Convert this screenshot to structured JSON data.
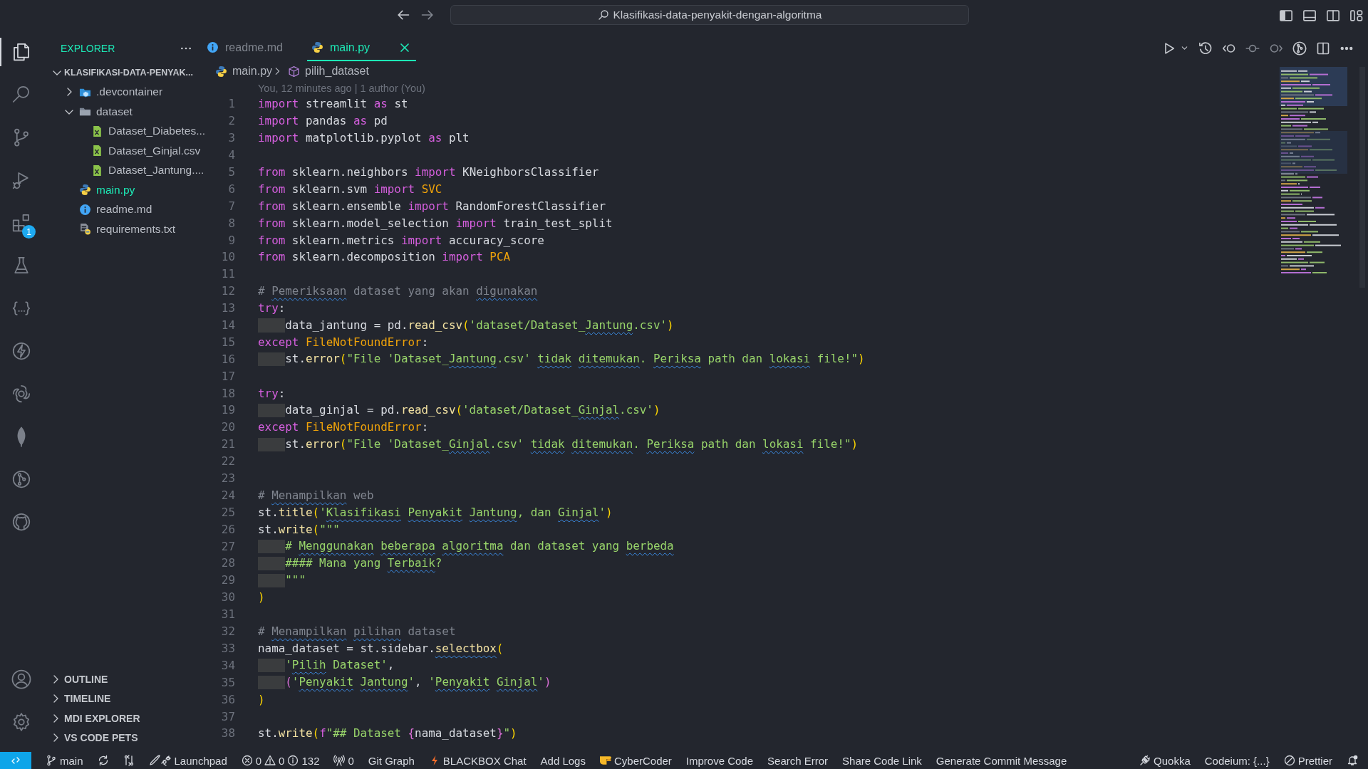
{
  "title_bar": {
    "search": "Klasifikasi-data-penyakit-dengan-algoritma"
  },
  "activity_bar": [
    {
      "kind": "explorer",
      "selected": true
    },
    {
      "kind": "search",
      "selected": false
    },
    {
      "kind": "source-control",
      "selected": false
    },
    {
      "kind": "run",
      "selected": false
    },
    {
      "kind": "extensions",
      "selected": false,
      "badge": "1"
    },
    {
      "kind": "flask",
      "selected": false
    },
    {
      "kind": "braces",
      "selected": false
    },
    {
      "kind": "bolt",
      "selected": false
    },
    {
      "kind": "knot",
      "selected": false
    },
    {
      "kind": "leaf",
      "selected": false
    },
    {
      "kind": "graph",
      "selected": false
    },
    {
      "kind": "cat",
      "selected": false
    }
  ],
  "activity_bottom": [
    {
      "kind": "account"
    },
    {
      "kind": "settings"
    }
  ],
  "sidebar": {
    "title": "EXPLORER",
    "tree": [
      {
        "label": "KLASIFIKASI-DATA-PENYAK...",
        "kind": "root",
        "expanded": true,
        "selected": false,
        "children": [
          {
            "label": ".devcontainer",
            "kind": "container-folder",
            "expanded": false,
            "selected": false
          },
          {
            "label": "dataset",
            "kind": "folder",
            "expanded": true,
            "selected": false,
            "children": [
              {
                "label": "Dataset_Diabetes...",
                "kind": "csv",
                "selected": false
              },
              {
                "label": "Dataset_Ginjal.csv",
                "kind": "csv",
                "selected": false
              },
              {
                "label": "Dataset_Jantung....",
                "kind": "csv",
                "selected": false
              }
            ]
          },
          {
            "label": "main.py",
            "kind": "python",
            "selected": true
          },
          {
            "label": "readme.md",
            "kind": "info",
            "selected": false
          },
          {
            "label": "requirements.txt",
            "kind": "requirements",
            "selected": false
          }
        ]
      }
    ],
    "sections": [
      {
        "label": "OUTLINE",
        "expanded": false
      },
      {
        "label": "TIMELINE",
        "expanded": false
      },
      {
        "label": "MDI EXPLORER",
        "expanded": false
      },
      {
        "label": "VS CODE PETS",
        "expanded": false
      }
    ]
  },
  "tabs": [
    {
      "label": "readme.md",
      "kind": "info",
      "selected": false
    },
    {
      "label": "main.py",
      "kind": "python",
      "selected": true
    }
  ],
  "breadcrumb": [
    {
      "label": "main.py",
      "kind": "python"
    },
    {
      "label": "pilih_dataset",
      "kind": "symbol"
    }
  ],
  "blame": "You, 12 minutes ago | 1 author (You)",
  "code": [
    {
      "number": "1",
      "tokens": [
        {
          "text": "import",
          "kind": "keyword"
        },
        {
          "text": " streamlit ",
          "kind": "plain"
        },
        {
          "text": "as",
          "kind": "keyword"
        },
        {
          "text": " st",
          "kind": "plain"
        }
      ]
    },
    {
      "number": "2",
      "tokens": [
        {
          "text": "import",
          "kind": "keyword"
        },
        {
          "text": " pandas ",
          "kind": "plain"
        },
        {
          "text": "as",
          "kind": "keyword"
        },
        {
          "text": " pd",
          "kind": "plain"
        }
      ]
    },
    {
      "number": "3",
      "tokens": [
        {
          "text": "import",
          "kind": "keyword"
        },
        {
          "text": " matplotlib.pyplot ",
          "kind": "plain"
        },
        {
          "text": "as",
          "kind": "keyword"
        },
        {
          "text": " plt",
          "kind": "plain"
        }
      ]
    },
    {
      "number": "4"
    },
    {
      "number": "5",
      "tokens": [
        {
          "text": "from",
          "kind": "keyword"
        },
        {
          "text": " sklearn.neighbors ",
          "kind": "plain"
        },
        {
          "text": "import",
          "kind": "keyword"
        },
        {
          "text": " KNeighborsClassifier",
          "kind": "plain"
        }
      ]
    },
    {
      "number": "6",
      "tokens": [
        {
          "text": "from",
          "kind": "keyword"
        },
        {
          "text": " sklearn.svm ",
          "kind": "plain"
        },
        {
          "text": "import",
          "kind": "keyword"
        },
        {
          "text": " SVC",
          "kind": "class"
        }
      ]
    },
    {
      "number": "7",
      "tokens": [
        {
          "text": "from",
          "kind": "keyword"
        },
        {
          "text": " sklearn.ensemble ",
          "kind": "plain"
        },
        {
          "text": "import",
          "kind": "keyword"
        },
        {
          "text": " RandomForestClassifier",
          "kind": "plain"
        }
      ]
    },
    {
      "number": "8",
      "tokens": [
        {
          "text": "from",
          "kind": "keyword"
        },
        {
          "text": " sklearn.model_selection ",
          "kind": "plain"
        },
        {
          "text": "import",
          "kind": "keyword"
        },
        {
          "text": " train_test_split",
          "kind": "plain"
        }
      ]
    },
    {
      "number": "9",
      "tokens": [
        {
          "text": "from",
          "kind": "keyword"
        },
        {
          "text": " sklearn.metrics ",
          "kind": "plain"
        },
        {
          "text": "import",
          "kind": "keyword"
        },
        {
          "text": " accuracy_score",
          "kind": "plain"
        }
      ]
    },
    {
      "number": "10",
      "tokens": [
        {
          "text": "from",
          "kind": "keyword"
        },
        {
          "text": " sklearn.decomposition ",
          "kind": "plain"
        },
        {
          "text": "import",
          "kind": "keyword"
        },
        {
          "text": " PCA",
          "kind": "class"
        }
      ]
    },
    {
      "number": "11"
    },
    {
      "number": "12",
      "tokens": [
        {
          "text": "# ",
          "kind": "comment"
        },
        {
          "text": "Pemeriksaan",
          "kind": "comment_typo"
        },
        {
          "text": " dataset yang akan ",
          "kind": "comment"
        },
        {
          "text": "digunakan",
          "kind": "comment_typo"
        }
      ]
    },
    {
      "number": "13",
      "tokens": [
        {
          "text": "try",
          "kind": "keyword"
        },
        {
          "text": ":",
          "kind": "plain"
        }
      ]
    },
    {
      "number": "14",
      "tokens": [
        {
          "kind": "indent"
        },
        {
          "text": "data_jantung = pd.",
          "kind": "plain"
        },
        {
          "text": "read_csv",
          "kind": "function"
        },
        {
          "text": "(",
          "kind": "bracket"
        },
        {
          "text": "'dataset/Dataset_",
          "kind": "string"
        },
        {
          "text": "Jantung",
          "kind": "string_typo"
        },
        {
          "text": ".csv'",
          "kind": "string"
        },
        {
          "text": ")",
          "kind": "bracket"
        }
      ]
    },
    {
      "number": "15",
      "tokens": [
        {
          "text": "except",
          "kind": "keyword"
        },
        {
          "text": " FileNotFoundError",
          "kind": "class"
        },
        {
          "text": ":",
          "kind": "plain"
        }
      ]
    },
    {
      "number": "16",
      "tokens": [
        {
          "kind": "indent"
        },
        {
          "text": "st.",
          "kind": "plain"
        },
        {
          "text": "error",
          "kind": "function"
        },
        {
          "text": "(",
          "kind": "bracket"
        },
        {
          "text": "\"File 'Dataset_",
          "kind": "string"
        },
        {
          "text": "Jantung",
          "kind": "string_typo"
        },
        {
          "text": ".csv' ",
          "kind": "string"
        },
        {
          "text": "tidak",
          "kind": "string_typo"
        },
        {
          "text": " ditemukan",
          "kind": "string_typo"
        },
        {
          "text": ". ",
          "kind": "string"
        },
        {
          "text": "Periksa",
          "kind": "string_typo"
        },
        {
          "text": " path dan ",
          "kind": "string"
        },
        {
          "text": "lokasi",
          "kind": "string_typo"
        },
        {
          "text": " file!\"",
          "kind": "string"
        },
        {
          "text": ")",
          "kind": "bracket"
        }
      ]
    },
    {
      "number": "17"
    },
    {
      "number": "18",
      "tokens": [
        {
          "text": "try",
          "kind": "keyword"
        },
        {
          "text": ":",
          "kind": "plain"
        }
      ]
    },
    {
      "number": "19",
      "tokens": [
        {
          "kind": "indent"
        },
        {
          "text": "data_ginjal = pd.",
          "kind": "plain"
        },
        {
          "text": "read_csv",
          "kind": "function"
        },
        {
          "text": "(",
          "kind": "bracket"
        },
        {
          "text": "'dataset/Dataset_",
          "kind": "string"
        },
        {
          "text": "Ginjal",
          "kind": "string_typo"
        },
        {
          "text": ".csv'",
          "kind": "string"
        },
        {
          "text": ")",
          "kind": "bracket"
        }
      ]
    },
    {
      "number": "20",
      "tokens": [
        {
          "text": "except",
          "kind": "keyword"
        },
        {
          "text": " FileNotFoundError",
          "kind": "class"
        },
        {
          "text": ":",
          "kind": "plain"
        }
      ]
    },
    {
      "number": "21",
      "tokens": [
        {
          "kind": "indent"
        },
        {
          "text": "st.",
          "kind": "plain"
        },
        {
          "text": "error",
          "kind": "function"
        },
        {
          "text": "(",
          "kind": "bracket"
        },
        {
          "text": "\"File 'Dataset_",
          "kind": "string"
        },
        {
          "text": "Ginjal",
          "kind": "string_typo"
        },
        {
          "text": ".csv' ",
          "kind": "string"
        },
        {
          "text": "tidak",
          "kind": "string_typo"
        },
        {
          "text": " ditemukan",
          "kind": "string_typo"
        },
        {
          "text": ". ",
          "kind": "string"
        },
        {
          "text": "Periksa",
          "kind": "string_typo"
        },
        {
          "text": " path dan ",
          "kind": "string"
        },
        {
          "text": "lokasi",
          "kind": "string_typo"
        },
        {
          "text": " file!\"",
          "kind": "string"
        },
        {
          "text": ")",
          "kind": "bracket"
        }
      ]
    },
    {
      "number": "22"
    },
    {
      "number": "23"
    },
    {
      "number": "24",
      "tokens": [
        {
          "text": "# ",
          "kind": "comment"
        },
        {
          "text": "Menampilkan",
          "kind": "comment_typo"
        },
        {
          "text": " web",
          "kind": "comment"
        }
      ]
    },
    {
      "number": "25",
      "tokens": [
        {
          "text": "st.",
          "kind": "plain"
        },
        {
          "text": "title",
          "kind": "function"
        },
        {
          "text": "(",
          "kind": "bracket"
        },
        {
          "text": "'",
          "kind": "string"
        },
        {
          "text": "Klasifikasi",
          "kind": "string_typo"
        },
        {
          "text": " Penyakit",
          "kind": "string_typo"
        },
        {
          "text": " Jantung",
          "kind": "string_typo"
        },
        {
          "text": ", dan ",
          "kind": "string"
        },
        {
          "text": "Ginjal",
          "kind": "string_typo"
        },
        {
          "text": "'",
          "kind": "string"
        },
        {
          "text": ")",
          "kind": "bracket"
        }
      ]
    },
    {
      "number": "26",
      "tokens": [
        {
          "text": "st.",
          "kind": "plain"
        },
        {
          "text": "write",
          "kind": "function"
        },
        {
          "text": "(",
          "kind": "bracket"
        },
        {
          "text": "\"\"\"",
          "kind": "string"
        }
      ]
    },
    {
      "number": "27",
      "tokens": [
        {
          "kind": "indent"
        },
        {
          "text": "# ",
          "kind": "string"
        },
        {
          "text": "Menggunakan",
          "kind": "string_typo"
        },
        {
          "text": " beberapa",
          "kind": "string_typo"
        },
        {
          "text": " algoritma",
          "kind": "string_typo"
        },
        {
          "text": " dan dataset yang ",
          "kind": "string"
        },
        {
          "text": "berbeda",
          "kind": "string_typo"
        }
      ]
    },
    {
      "number": "28",
      "tokens": [
        {
          "kind": "indent"
        },
        {
          "text": "#### Mana yang ",
          "kind": "string"
        },
        {
          "text": "Terbaik",
          "kind": "string_typo"
        },
        {
          "text": "?",
          "kind": "string"
        }
      ]
    },
    {
      "number": "29",
      "tokens": [
        {
          "kind": "indent"
        },
        {
          "text": "\"\"\"",
          "kind": "string"
        }
      ]
    },
    {
      "number": "30",
      "tokens": [
        {
          "text": ")",
          "kind": "bracket"
        }
      ]
    },
    {
      "number": "31"
    },
    {
      "number": "32",
      "tokens": [
        {
          "text": "# ",
          "kind": "comment"
        },
        {
          "text": "Menampilkan",
          "kind": "comment_typo"
        },
        {
          "text": " pilihan",
          "kind": "comment_typo"
        },
        {
          "text": " dataset",
          "kind": "comment"
        }
      ]
    },
    {
      "number": "33",
      "tokens": [
        {
          "text": "nama_dataset = st.sidebar.",
          "kind": "plain"
        },
        {
          "text": "selectbox",
          "kind": "function_typo"
        },
        {
          "text": "(",
          "kind": "bracket"
        }
      ]
    },
    {
      "number": "34",
      "tokens": [
        {
          "kind": "indent"
        },
        {
          "text": "'",
          "kind": "string"
        },
        {
          "text": "Pilih",
          "kind": "string_typo"
        },
        {
          "text": " Dataset'",
          "kind": "string"
        },
        {
          "text": ",",
          "kind": "plain"
        }
      ]
    },
    {
      "number": "35",
      "tokens": [
        {
          "kind": "indent"
        },
        {
          "text": "(",
          "kind": "bracket2"
        },
        {
          "text": "'",
          "kind": "string"
        },
        {
          "text": "Penyakit",
          "kind": "string_typo"
        },
        {
          "text": " Jantung",
          "kind": "string_typo"
        },
        {
          "text": "'",
          "kind": "string"
        },
        {
          "text": ", ",
          "kind": "plain"
        },
        {
          "text": "'",
          "kind": "string"
        },
        {
          "text": "Penyakit",
          "kind": "string_typo"
        },
        {
          "text": " Ginjal",
          "kind": "string_typo"
        },
        {
          "text": "'",
          "kind": "string"
        },
        {
          "text": ")",
          "kind": "bracket2"
        }
      ]
    },
    {
      "number": "36",
      "tokens": [
        {
          "text": ")",
          "kind": "bracket"
        }
      ]
    },
    {
      "number": "37"
    },
    {
      "number": "38",
      "tokens": [
        {
          "text": "st.",
          "kind": "plain"
        },
        {
          "text": "write",
          "kind": "function"
        },
        {
          "text": "(",
          "kind": "bracket"
        },
        {
          "text": "f",
          "kind": "keyword"
        },
        {
          "text": "\"## Dataset ",
          "kind": "string"
        },
        {
          "text": "{",
          "kind": "bracket2"
        },
        {
          "text": "nama_dataset",
          "kind": "plain"
        },
        {
          "text": "}",
          "kind": "bracket2"
        },
        {
          "text": "\"",
          "kind": "string"
        },
        {
          "text": ")",
          "kind": "bracket"
        }
      ]
    }
  ],
  "status_bar": {
    "left": [
      {
        "kind": "remote"
      },
      {
        "kind": "branch",
        "text": "main"
      },
      {
        "kind": "sync"
      },
      {
        "kind": "compare"
      },
      {
        "kind": "launchpad",
        "text": "Launchpad"
      },
      {
        "kind": "problems",
        "errors": "0",
        "warnings": "0",
        "infos": "132"
      },
      {
        "kind": "ports",
        "text": "0"
      },
      {
        "kind": "plain",
        "text": "Git Graph"
      },
      {
        "kind": "bolt",
        "text": "BLACKBOX Chat"
      },
      {
        "kind": "plain",
        "text": "Add Logs"
      },
      {
        "kind": "hand",
        "text": "CyberCoder"
      },
      {
        "kind": "plain",
        "text": "Improve Code"
      },
      {
        "kind": "plain",
        "text": "Search Error"
      },
      {
        "kind": "plain",
        "text": "Share Code Link"
      },
      {
        "kind": "plain",
        "text": "Generate Commit Message"
      }
    ],
    "right": [
      {
        "kind": "plug",
        "text": "Quokka"
      },
      {
        "kind": "plain",
        "text": "Codeium: {...}"
      },
      {
        "kind": "blocked",
        "text": "Prettier"
      },
      {
        "kind": "bell"
      }
    ]
  }
}
